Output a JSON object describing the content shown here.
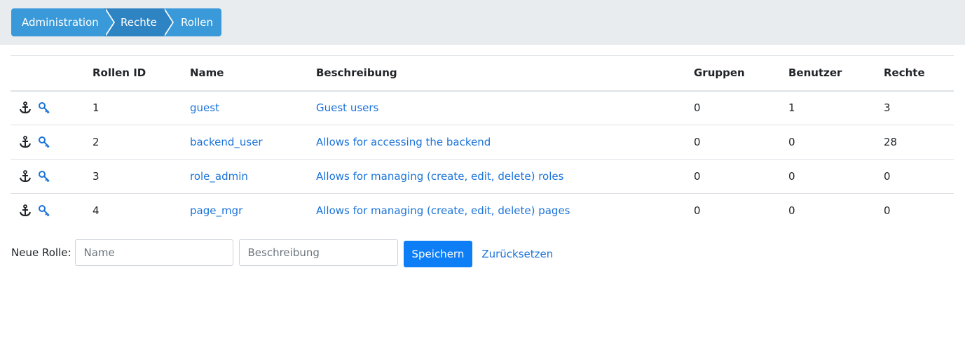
{
  "breadcrumb": [
    "Administration",
    "Rechte",
    "Rollen"
  ],
  "table": {
    "headers": [
      "",
      "Rollen ID",
      "Name",
      "Beschreibung",
      "Gruppen",
      "Benutzer",
      "Rechte"
    ],
    "rows": [
      {
        "id": "1",
        "name": "guest",
        "description": "Guest users",
        "groups": "0",
        "users": "1",
        "rights": "3"
      },
      {
        "id": "2",
        "name": "backend_user",
        "description": "Allows for accessing the backend",
        "groups": "0",
        "users": "0",
        "rights": "28"
      },
      {
        "id": "3",
        "name": "role_admin",
        "description": "Allows for managing (create, edit, delete) roles",
        "groups": "0",
        "users": "0",
        "rights": "0"
      },
      {
        "id": "4",
        "name": "page_mgr",
        "description": "Allows for managing (create, edit, delete) pages",
        "groups": "0",
        "users": "0",
        "rights": "0"
      }
    ]
  },
  "new_role": {
    "label": "Neue Rolle:",
    "name_placeholder": "Name",
    "description_placeholder": "Beschreibung",
    "save_label": "Speichern",
    "reset_label": "Zurücksetzen"
  },
  "icons": {
    "anchor": "anchor-icon",
    "key": "key-icon"
  },
  "colors": {
    "link": "#1a73d9",
    "button": "#0d7ef5",
    "crumb": "#3a9ad9",
    "crumb_active": "#2e83c2"
  }
}
